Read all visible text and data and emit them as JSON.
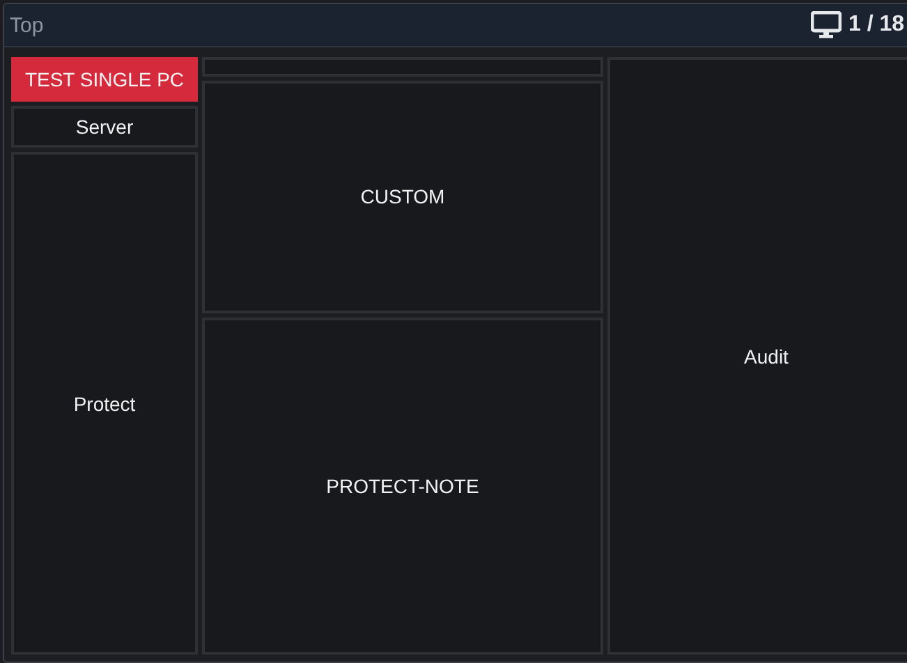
{
  "header": {
    "title": "Top",
    "count": "1 / 18"
  },
  "columns": [
    {
      "tiles": [
        {
          "label": "TEST SINGLE PC",
          "selected": true
        },
        {
          "label": "Server",
          "selected": false
        },
        {
          "label": "Protect",
          "selected": false
        }
      ]
    },
    {
      "tiles": [
        {
          "label": "CUSTOM",
          "selected": false
        },
        {
          "label": "PROTECT-NOTE",
          "selected": false
        }
      ]
    },
    {
      "tiles": [
        {
          "label": "Audit",
          "selected": false
        }
      ]
    }
  ]
}
